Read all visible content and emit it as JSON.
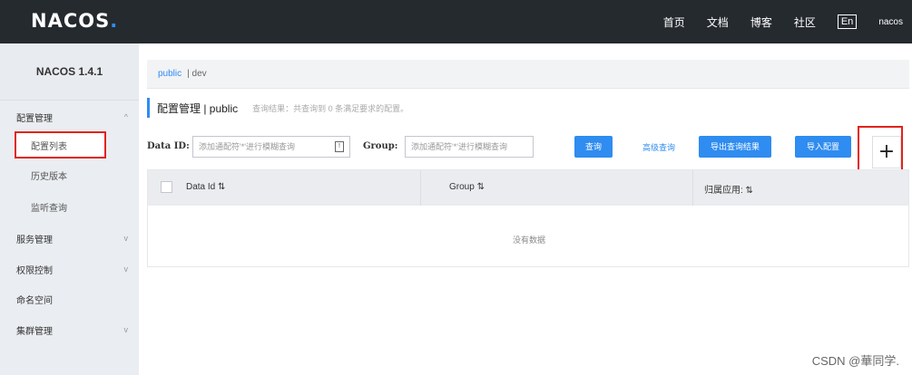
{
  "header": {
    "logo": "NACOS",
    "logo_dot": ".",
    "nav": [
      "首页",
      "文档",
      "博客",
      "社区"
    ],
    "lang": "En",
    "user": "nacos"
  },
  "sidebar": {
    "version": "NACOS 1.4.1",
    "items": [
      {
        "label": "配置管理",
        "arrow": "^"
      },
      {
        "label": "配置列表"
      },
      {
        "label": "历史版本"
      },
      {
        "label": "监听查询"
      },
      {
        "label": "服务管理",
        "arrow": "v"
      },
      {
        "label": "权限控制",
        "arrow": "v"
      },
      {
        "label": "命名空间"
      },
      {
        "label": "集群管理",
        "arrow": "v"
      }
    ]
  },
  "breadcrumb": {
    "ns": "public",
    "sep": "| dev"
  },
  "title": {
    "main": "配置管理  |  public",
    "hint": "查询结果：共查询到 0 条满足要求的配置。"
  },
  "search": {
    "dataid_label": "Data ID:",
    "dataid_placeholder": "添加通配符'*'进行模糊查询",
    "group_label": "Group:",
    "group_placeholder": "添加通配符'*'进行模糊查询",
    "query_btn": "查询",
    "advanced": "高级查询",
    "export_btn": "导出查询结果",
    "import_btn": "导入配置",
    "add": "+"
  },
  "table": {
    "columns": [
      "Data Id ⇅",
      "Group ⇅",
      "归属应用: ⇅"
    ],
    "empty": "没有数据"
  },
  "watermark": "CSDN @華同学."
}
